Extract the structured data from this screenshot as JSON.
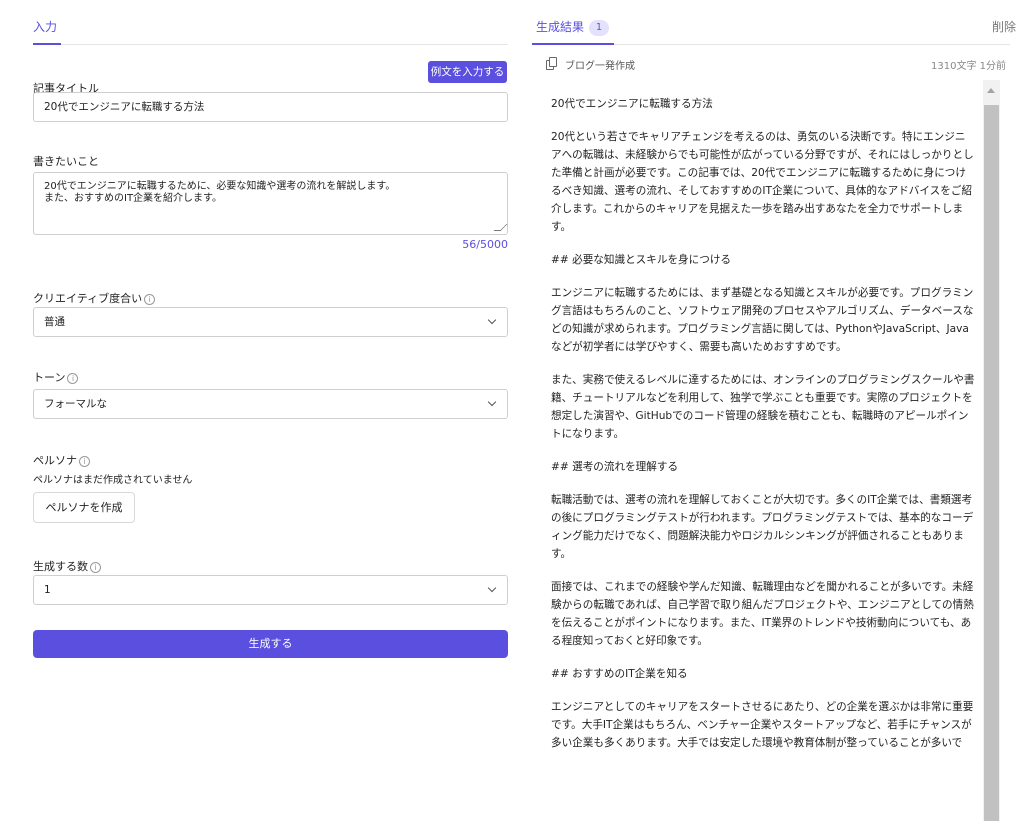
{
  "input_panel": {
    "tab_label": "入力",
    "example_button": "例文を入力する",
    "title_field": {
      "label": "記事タイトル",
      "value": "20代でエンジニアに転職する方法"
    },
    "content_field": {
      "label": "書きたいこと",
      "line1": "20代でエンジニアに転職するために、必要な知識や選考の流れを解説します。",
      "line2": "また、おすすめのIT企業を紹介します。",
      "counter": "56/5000"
    },
    "creativity": {
      "label": "クリエイティブ度合い",
      "value": "普通"
    },
    "tone": {
      "label": "トーン",
      "value": "フォーマルな"
    },
    "persona": {
      "label": "ペルソナ",
      "note": "ペルソナはまだ作成されていません",
      "button": "ペルソナを作成"
    },
    "count": {
      "label": "生成する数",
      "value": "1"
    },
    "generate_button": "生成する"
  },
  "result_panel": {
    "tab_label": "生成結果",
    "badge": "1",
    "delete_label": "削除",
    "card": {
      "title": "ブログ一発作成",
      "meta": "1310文字 1分前",
      "paragraphs": [
        "20代でエンジニアに転職する方法",
        "20代という若さでキャリアチェンジを考えるのは、勇気のいる決断です。特にエンジニアへの転職は、未経験からでも可能性が広がっている分野ですが、それにはしっかりとした準備と計画が必要です。この記事では、20代でエンジニアに転職するために身につけるべき知識、選考の流れ、そしておすすめのIT企業について、具体的なアドバイスをご紹介します。これからのキャリアを見据えた一歩を踏み出すあなたを全力でサポートします。",
        "## 必要な知識とスキルを身につける",
        "エンジニアに転職するためには、まず基礎となる知識とスキルが必要です。プログラミング言語はもちろんのこと、ソフトウェア開発のプロセスやアルゴリズム、データベースなどの知識が求められます。プログラミング言語に関しては、PythonやJavaScript、Javaなどが初学者には学びやすく、需要も高いためおすすめです。",
        "また、実務で使えるレベルに達するためには、オンラインのプログラミングスクールや書籍、チュートリアルなどを利用して、独学で学ぶことも重要です。実際のプロジェクトを想定した演習や、GitHubでのコード管理の経験を積むことも、転職時のアピールポイントになります。",
        "## 選考の流れを理解する",
        "転職活動では、選考の流れを理解しておくことが大切です。多くのIT企業では、書類選考の後にプログラミングテストが行われます。プログラミングテストでは、基本的なコーディング能力だけでなく、問題解決能力やロジカルシンキングが評価されることもあります。",
        "面接では、これまでの経験や学んだ知識、転職理由などを聞かれることが多いです。未経験からの転職であれば、自己学習で取り組んだプロジェクトや、エンジニアとしての情熱を伝えることがポイントになります。また、IT業界のトレンドや技術動向についても、ある程度知っておくと好印象です。",
        "## おすすめのIT企業を知る",
        "エンジニアとしてのキャリアをスタートさせるにあたり、どの企業を選ぶかは非常に重要です。大手IT企業はもちろん、ベンチャー企業やスタートアップなど、若手にチャンスが多い企業も多くあります。大手では安定した環境や教育体制が整っていることが多いで"
      ]
    }
  }
}
